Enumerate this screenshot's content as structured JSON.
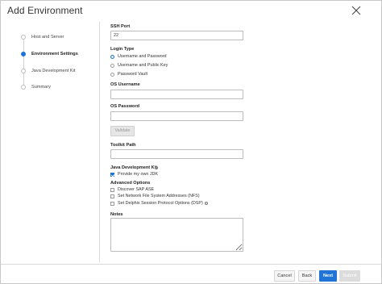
{
  "dialog": {
    "title": "Add Environment"
  },
  "steps": [
    {
      "label": "Host and Server",
      "active": false
    },
    {
      "label": "Environment Settings",
      "active": true
    },
    {
      "label": "Java Development Kit",
      "active": false
    },
    {
      "label": "Summary",
      "active": false
    }
  ],
  "form": {
    "ssh_port_label": "SSH Port",
    "ssh_port_value": "22",
    "login_type_label": "Login Type",
    "login_options": [
      {
        "label": "Username and Password",
        "selected": true
      },
      {
        "label": "Username and Public Key",
        "selected": false
      },
      {
        "label": "Password Vault",
        "selected": false
      }
    ],
    "os_username_label": "OS Username",
    "os_username_value": "",
    "os_password_label": "OS Password",
    "os_password_value": "",
    "validate_label": "Validate",
    "toolkit_path_label": "Toolkit Path",
    "toolkit_path_value": "",
    "jdk_label": "Java Development Kit",
    "jdk_option": {
      "label": "Provide my own JDK",
      "checked": true
    },
    "advanced_label": "Advanced Options",
    "advanced_options": [
      {
        "label": "Discover SAP ASE",
        "checked": false
      },
      {
        "label": "Set Network File System Addresses (NFS)",
        "checked": false
      },
      {
        "label": "Set Delphix Session Protocol Options (DSP)",
        "checked": false
      }
    ],
    "notes_label": "Notes",
    "notes_value": ""
  },
  "footer": {
    "cancel_label": "Cancel",
    "back_label": "Back",
    "next_label": "Next",
    "submit_label": "Submit"
  },
  "colors": {
    "accent": "#1f74d6",
    "disabled": "#dcdcdc"
  }
}
